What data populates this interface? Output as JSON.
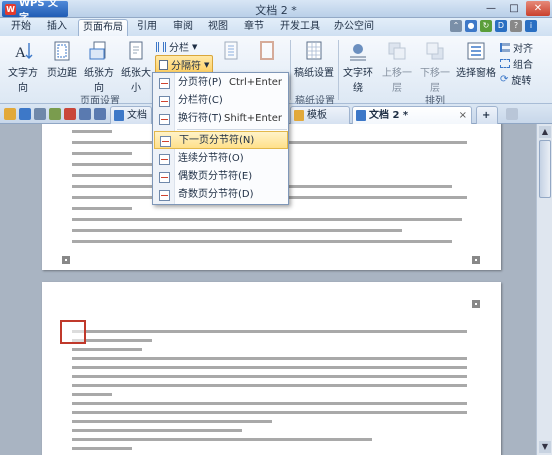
{
  "app": {
    "name": "WPS 文字",
    "title": "文档 2 *"
  },
  "window_controls": {
    "minimize": "—",
    "maximize": "□",
    "close": "✕"
  },
  "tabs": [
    {
      "label": "开始"
    },
    {
      "label": "插入"
    },
    {
      "label": "页面布局"
    },
    {
      "label": "引用"
    },
    {
      "label": "审阅"
    },
    {
      "label": "视图"
    },
    {
      "label": "章节"
    },
    {
      "label": "开发工具"
    },
    {
      "label": "办公空间"
    }
  ],
  "active_tab": "页面布局",
  "ribbon": {
    "text_direction": "文字方向",
    "margins": "页边距",
    "orientation": "纸张方向",
    "size": "纸张大小",
    "columns": "分栏",
    "breaks": "分隔符",
    "page_setup_group": "页面设置",
    "paper_setup": "稿纸设置",
    "paper_group": "稿纸设置",
    "text_wrap": "文字环绕",
    "bring_forward": "上移一层",
    "send_backward": "下移一层",
    "selection_pane": "选择窗格",
    "align": "对齐",
    "group": "组合",
    "rotate": "旋转",
    "arrange_group": "排列"
  },
  "doc_tabs": [
    {
      "label": "文档 1"
    },
    {
      "label": "模板"
    },
    {
      "label": "文档 2 *"
    }
  ],
  "breaks_menu": {
    "items": [
      {
        "label": "分页符(P)",
        "shortcut": "Ctrl+Enter"
      },
      {
        "label": "分栏符(C)",
        "shortcut": ""
      },
      {
        "label": "换行符(T)",
        "shortcut": "Shift+Enter"
      },
      {
        "label": "下一页分节符(N)",
        "shortcut": ""
      },
      {
        "label": "连续分节符(O)",
        "shortcut": ""
      },
      {
        "label": "偶数页分节符(E)",
        "shortcut": ""
      },
      {
        "label": "奇数页分节符(D)",
        "shortcut": ""
      }
    ],
    "highlighted": "下一页分节符(N)"
  },
  "colors": {
    "accent": "#1f5cb4",
    "highlight": "#ffd063",
    "page": "#ffffff",
    "workspace": "#a9b4c2"
  }
}
